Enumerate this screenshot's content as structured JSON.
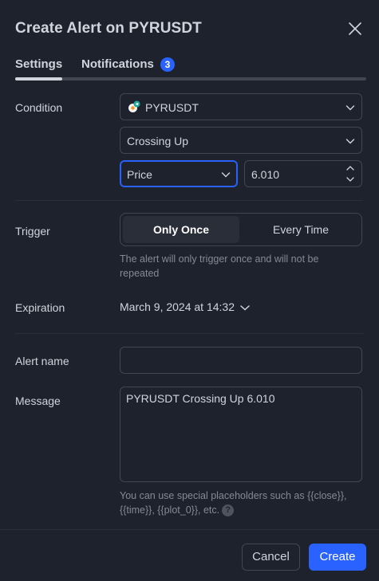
{
  "dialog": {
    "title": "Create Alert on PYRUSDT",
    "tabs": [
      {
        "label": "Settings",
        "active": true
      },
      {
        "label": "Notifications",
        "badge": "3"
      }
    ]
  },
  "condition": {
    "label": "Condition",
    "symbol": "PYRUSDT",
    "operator": "Crossing Up",
    "source": "Price",
    "value": "6.010"
  },
  "trigger": {
    "label": "Trigger",
    "options": [
      "Only Once",
      "Every Time"
    ],
    "selected": "Only Once",
    "hint_line1": "The alert will only trigger once and will not be",
    "hint_line2": "repeated"
  },
  "expiration": {
    "label": "Expiration",
    "value": "March 9, 2024 at 14:32"
  },
  "alert_name": {
    "label": "Alert name",
    "value": "",
    "placeholder": ""
  },
  "message": {
    "label": "Message",
    "value": "PYRUSDT Crossing Up 6.010",
    "hint_line1": "You can use special placeholders such as {{close}},",
    "hint_line2": "{{time}}, {{plot_0}}, etc.",
    "help_glyph": "?"
  },
  "footer": {
    "cancel_label": "Cancel",
    "create_label": "Create"
  },
  "colors": {
    "background": "#1e222d",
    "accent": "#2962ff",
    "border": "#434651",
    "text": "#d1d4dc",
    "muted": "#868993"
  },
  "icons": {
    "close": "close-icon",
    "symbol": "pyr-coin-icon",
    "chevron": "chevron-down-icon",
    "stepper": "stepper-icon",
    "help": "question-icon"
  }
}
